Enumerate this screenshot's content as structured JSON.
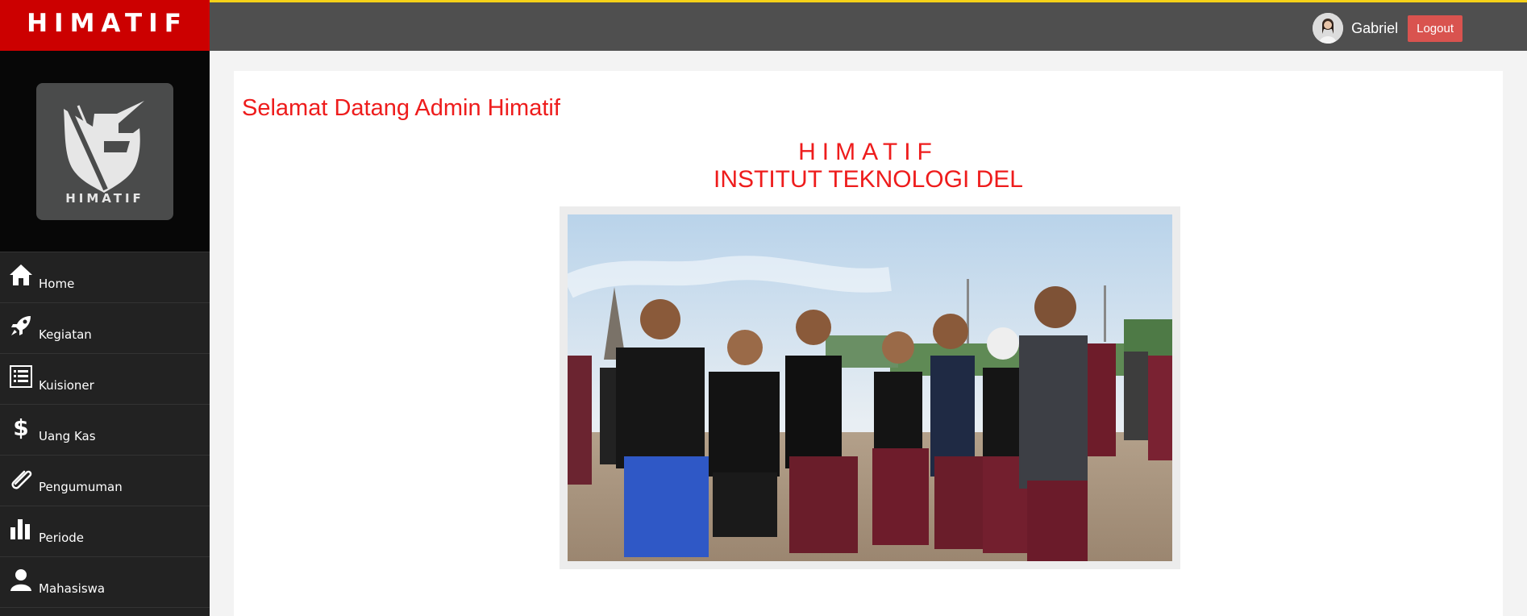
{
  "brand": {
    "title": "HIMATIF"
  },
  "header": {
    "user_name": "Gabriel",
    "logout_label": "Logout"
  },
  "sidebar": {
    "logo_text": "HIMATIF",
    "items": [
      {
        "label": "Home",
        "icon": "home-icon"
      },
      {
        "label": "Kegiatan",
        "icon": "rocket-icon"
      },
      {
        "label": "Kuisioner",
        "icon": "list-icon"
      },
      {
        "label": "Uang Kas",
        "icon": "dollar-icon"
      },
      {
        "label": "Pengumuman",
        "icon": "paperclip-icon"
      },
      {
        "label": "Periode",
        "icon": "bar-chart-icon"
      },
      {
        "label": "Mahasiswa",
        "icon": "user-icon"
      }
    ]
  },
  "main": {
    "welcome": "Selamat Datang Admin Himatif",
    "heading_line1": "HIMATIF",
    "heading_line2": "INSTITUT TEKNOLOGI DEL"
  },
  "colors": {
    "brand_red": "#cc0000",
    "accent_yellow": "#f5d118",
    "topbar": "#4f4f4f",
    "sidebar": "#222222",
    "title_red": "#ee1c1c",
    "logout": "#d9534f"
  }
}
